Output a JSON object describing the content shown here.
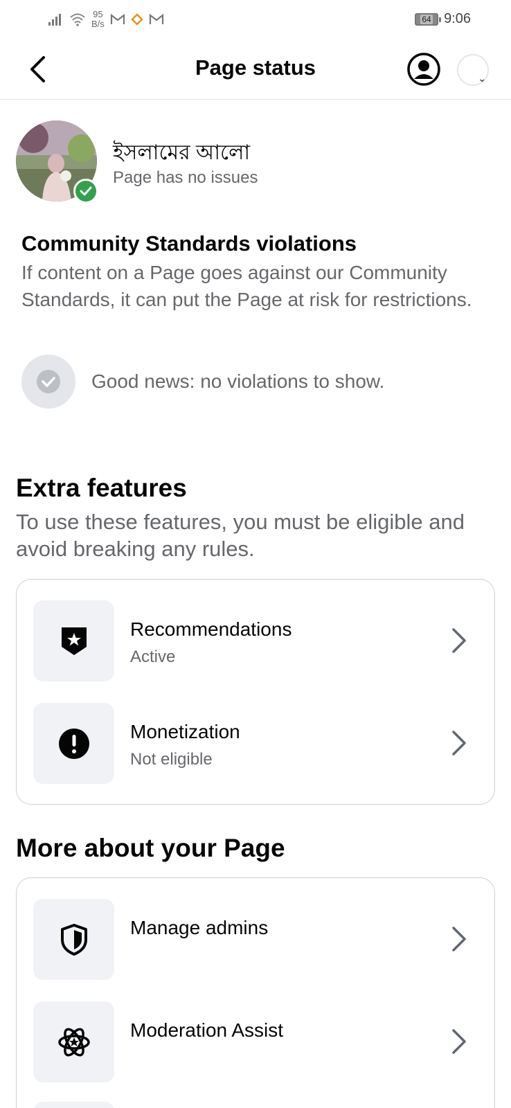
{
  "status_bar": {
    "speed_value": "95",
    "speed_unit": "B/s",
    "battery": "64",
    "time": "9:06"
  },
  "header": {
    "title": "Page status"
  },
  "page": {
    "name": "ইসলামের আলো",
    "status": "Page has no issues"
  },
  "community_standards": {
    "title": "Community Standards violations",
    "description": "If content on a Page goes against our Community Standards, it can put the Page at risk for restrictions.",
    "good_news": "Good news: no violations to show."
  },
  "extra_features": {
    "title": "Extra features",
    "description": "To use these features, you must be eligible and avoid breaking any rules.",
    "items": [
      {
        "label": "Recommendations",
        "status": "Active",
        "icon": "recommendations-badge-icon"
      },
      {
        "label": "Monetization",
        "status": "Not eligible",
        "icon": "alert-circle-icon"
      }
    ]
  },
  "more_about": {
    "title": "More about your Page",
    "items": [
      {
        "label": "Manage admins",
        "icon": "shield-icon"
      },
      {
        "label": "Moderation Assist",
        "icon": "moderation-atom-icon"
      }
    ]
  },
  "colors": {
    "success_green": "#31a24c",
    "secondary_text": "#65676b",
    "card_border": "#ced0d4",
    "icon_bg": "#f0f2f5"
  }
}
